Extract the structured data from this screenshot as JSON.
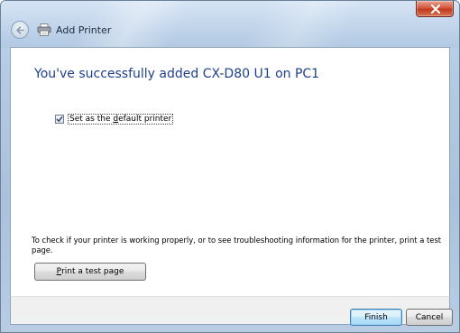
{
  "window": {
    "title": "Add Printer"
  },
  "main": {
    "heading": "You've successfully added CX-D80 U1 on PC1",
    "default_printer_checkbox": {
      "checked": true,
      "label_before": "Set as the ",
      "label_mnemonic": "d",
      "label_after": "efault printer"
    },
    "info_text": "To check if your printer is working properly, or to see troubleshooting information for the printer, print a test page.",
    "print_test_button": {
      "mnemonic": "P",
      "label_after": "rint a test page"
    }
  },
  "footer": {
    "finish_label": "Finish",
    "cancel_label": "Cancel"
  },
  "icons": {
    "back": "back-arrow-icon",
    "printer": "printer-icon",
    "close": "close-icon",
    "check": "checkmark-icon"
  },
  "colors": {
    "heading": "#1e3f8c",
    "close_button": "#c13b1f",
    "finish_button_border": "#3c7fb1"
  }
}
